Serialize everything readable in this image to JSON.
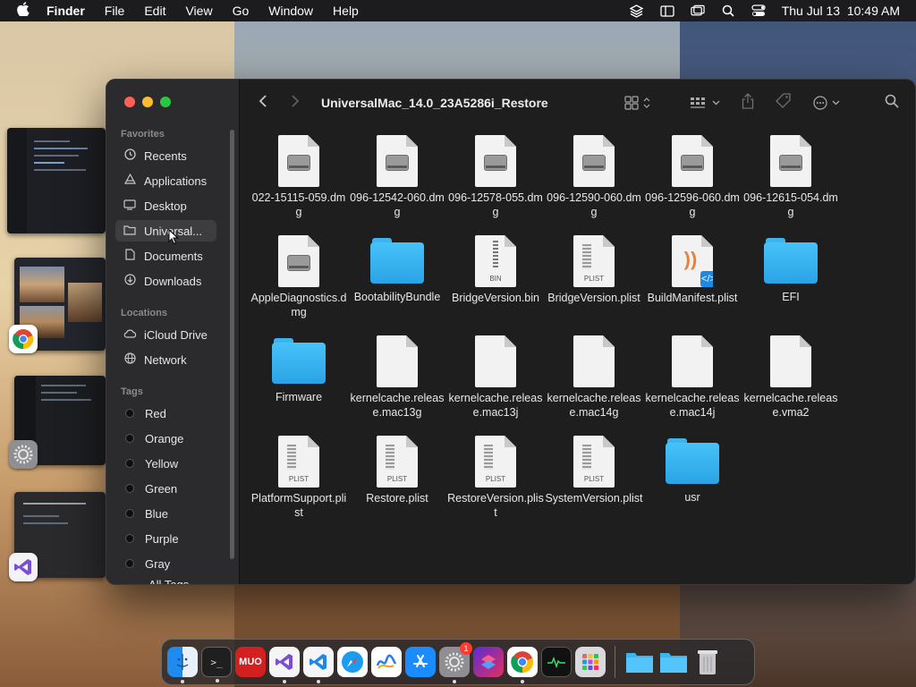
{
  "menubar": {
    "app": "Finder",
    "items": [
      "File",
      "Edit",
      "View",
      "Go",
      "Window",
      "Help"
    ],
    "datetime": "Thu Jul 13  10:49 AM"
  },
  "sidebar": {
    "favorites_title": "Favorites",
    "favorites": [
      {
        "label": "Recents",
        "icon": "clock-icon"
      },
      {
        "label": "Applications",
        "icon": "applications-icon"
      },
      {
        "label": "Desktop",
        "icon": "desktop-icon"
      },
      {
        "label": "Universal...",
        "icon": "folder-icon",
        "selected": true
      },
      {
        "label": "Documents",
        "icon": "document-icon"
      },
      {
        "label": "Downloads",
        "icon": "download-icon"
      }
    ],
    "locations_title": "Locations",
    "locations": [
      {
        "label": "iCloud Drive",
        "icon": "cloud-icon"
      },
      {
        "label": "Network",
        "icon": "network-icon"
      }
    ],
    "tags_title": "Tags",
    "tags": [
      "Red",
      "Orange",
      "Yellow",
      "Green",
      "Blue",
      "Purple",
      "Gray",
      "All Tags..."
    ]
  },
  "window": {
    "title": "UniversalMac_14.0_23A5286i_Restore"
  },
  "files": [
    {
      "name": "022-15115-059.dmg",
      "type": "dmg"
    },
    {
      "name": "096-12542-060.dmg",
      "type": "dmg"
    },
    {
      "name": "096-12578-055.dmg",
      "type": "dmg"
    },
    {
      "name": "096-12590-060.dmg",
      "type": "dmg"
    },
    {
      "name": "096-12596-060.dmg",
      "type": "dmg"
    },
    {
      "name": "096-12615-054.dmg",
      "type": "dmg"
    },
    {
      "name": "AppleDiagnostics.dmg",
      "type": "dmg"
    },
    {
      "name": "BootabilityBundle",
      "type": "folder"
    },
    {
      "name": "BridgeVersion.bin",
      "type": "bin",
      "badge": "BIN"
    },
    {
      "name": "BridgeVersion.plist",
      "type": "plist",
      "badge": "PLIST"
    },
    {
      "name": "BuildManifest.plist",
      "type": "rss"
    },
    {
      "name": "EFI",
      "type": "folder"
    },
    {
      "name": "Firmware",
      "type": "folder"
    },
    {
      "name": "kernelcache.release.mac13g",
      "type": "blank"
    },
    {
      "name": "kernelcache.release.mac13j",
      "type": "blank"
    },
    {
      "name": "kernelcache.release.mac14g",
      "type": "blank"
    },
    {
      "name": "kernelcache.release.mac14j",
      "type": "blank"
    },
    {
      "name": "kernelcache.release.vma2",
      "type": "blank"
    },
    {
      "name": "PlatformSupport.plist",
      "type": "plist",
      "badge": "PLIST"
    },
    {
      "name": "Restore.plist",
      "type": "plist",
      "badge": "PLIST"
    },
    {
      "name": "RestoreVersion.plist",
      "type": "plist",
      "badge": "PLIST"
    },
    {
      "name": "SystemVersion.plist",
      "type": "plist",
      "badge": "PLIST"
    },
    {
      "name": "usr",
      "type": "folder"
    }
  ],
  "dock": {
    "apps": [
      "finder",
      "terminal",
      "muo",
      "visual-studio",
      "vscode",
      "safari",
      "freeform",
      "app-store",
      "system-settings",
      "shortcuts",
      "chrome",
      "activity-monitor",
      "launchpad"
    ],
    "settings_badge": "1",
    "muo_label": "MUO"
  },
  "colors": {
    "accent": "#0a84ff",
    "folder": "#3cb4f0",
    "window_bg": "#1e1e1e",
    "sidebar_bg": "#2b2b2d"
  }
}
